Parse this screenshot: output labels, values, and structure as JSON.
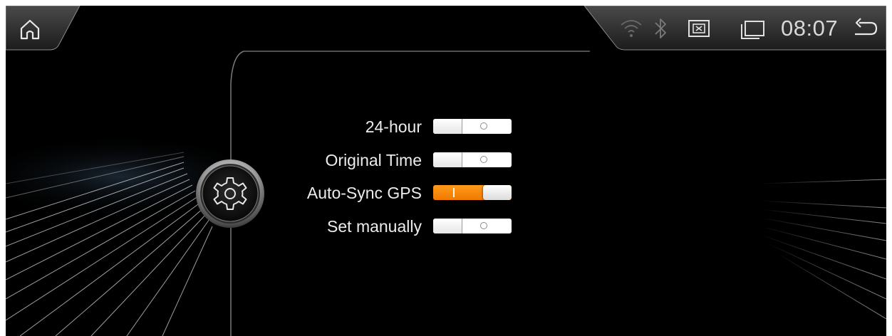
{
  "status_bar": {
    "time": "08:07",
    "icons": [
      "home-icon",
      "wifi-icon",
      "bluetooth-icon",
      "close-box-icon",
      "window-icon",
      "back-arrow-icon"
    ]
  },
  "settings": [
    {
      "label": "24-hour",
      "state": "off"
    },
    {
      "label": "Original Time",
      "state": "off"
    },
    {
      "label": "Auto-Sync GPS",
      "state": "on"
    },
    {
      "label": "Set manually",
      "state": "off"
    }
  ],
  "colors": {
    "accent": "#f58200",
    "background": "#000000",
    "text": "#ececec"
  }
}
